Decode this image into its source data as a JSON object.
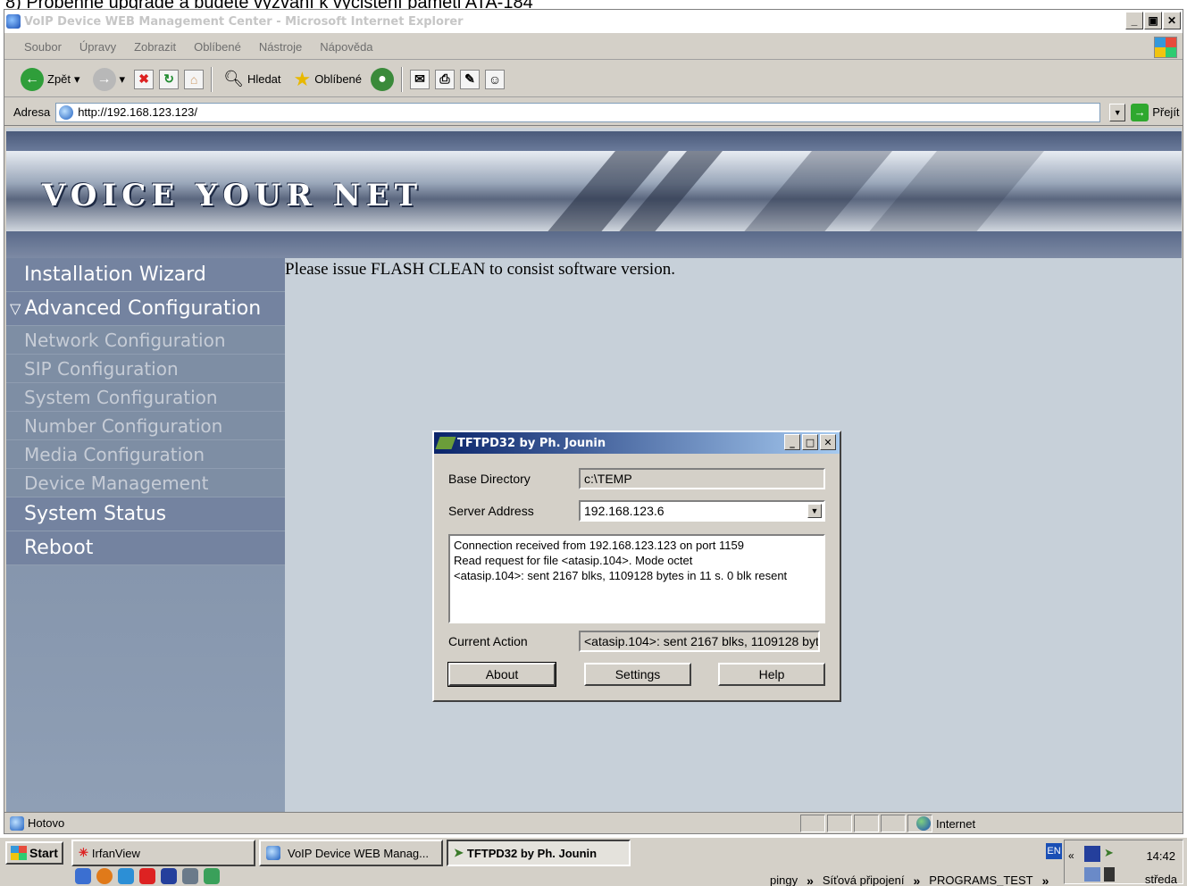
{
  "caption": "8)   Proběhne upgrade a budete vyzvání k vyčištění paměti ATA-184",
  "browser": {
    "title": "VoIP Device WEB Management Center - Microsoft Internet Explorer",
    "window_buttons": [
      "_",
      "ø",
      "×"
    ],
    "menu": [
      "Soubor",
      "Úpravy",
      "Zobrazit",
      "Oblíbené",
      "Nástroje",
      "Nápověda"
    ],
    "toolbar": {
      "back": "Zpět",
      "search": "Hledat",
      "favorites": "Oblíbené"
    },
    "address_label": "Adresa",
    "address_value": "http://192.168.123.123/",
    "go_label": "Přejít",
    "status_text": "Hotovo",
    "status_zone": "Internet"
  },
  "page": {
    "brand": "VOICE YOUR NET",
    "message": "Please issue FLASH CLEAN to consist software version.",
    "nav": {
      "installation_wizard": "Installation Wizard",
      "advanced_configuration": "Advanced Configuration",
      "sub": [
        "Network Configuration",
        "SIP Configuration",
        "System Configuration",
        "Number Configuration",
        "Media Configuration",
        "Device Management"
      ],
      "system_status": "System Status",
      "reboot": "Reboot"
    }
  },
  "dialog": {
    "title": "TFTPD32 by Ph. Jounin",
    "base_directory_label": "Base Directory",
    "base_directory_value": "c:\\TEMP",
    "server_address_label": "Server Address",
    "server_address_value": "192.168.123.6",
    "log": [
      "Connection received from 192.168.123.123 on port 1159",
      "Read request for file <atasip.104>. Mode octet",
      "<atasip.104>: sent 2167 blks, 1109128 bytes in 11 s. 0 blk resent"
    ],
    "current_action_label": "Current Action",
    "current_action_value": "<atasip.104>: sent 2167 blks, 1109128 byt",
    "buttons": {
      "about": "About",
      "settings": "Settings",
      "help": "Help"
    }
  },
  "taskbar": {
    "start": "Start",
    "tasks": [
      "IrfanView",
      "VoIP Device WEB Manag...",
      "TFTPD32 by Ph. Jounin"
    ],
    "links": [
      "pingy",
      "Síťová připojení",
      "PROGRAMS_TEST"
    ],
    "lang": "EN",
    "time": "14:42",
    "day": "středa"
  },
  "colors": {
    "sidebar": "#7e8ea4",
    "content_bg": "#c7d0d9",
    "dialog_title": "#0a246a"
  }
}
